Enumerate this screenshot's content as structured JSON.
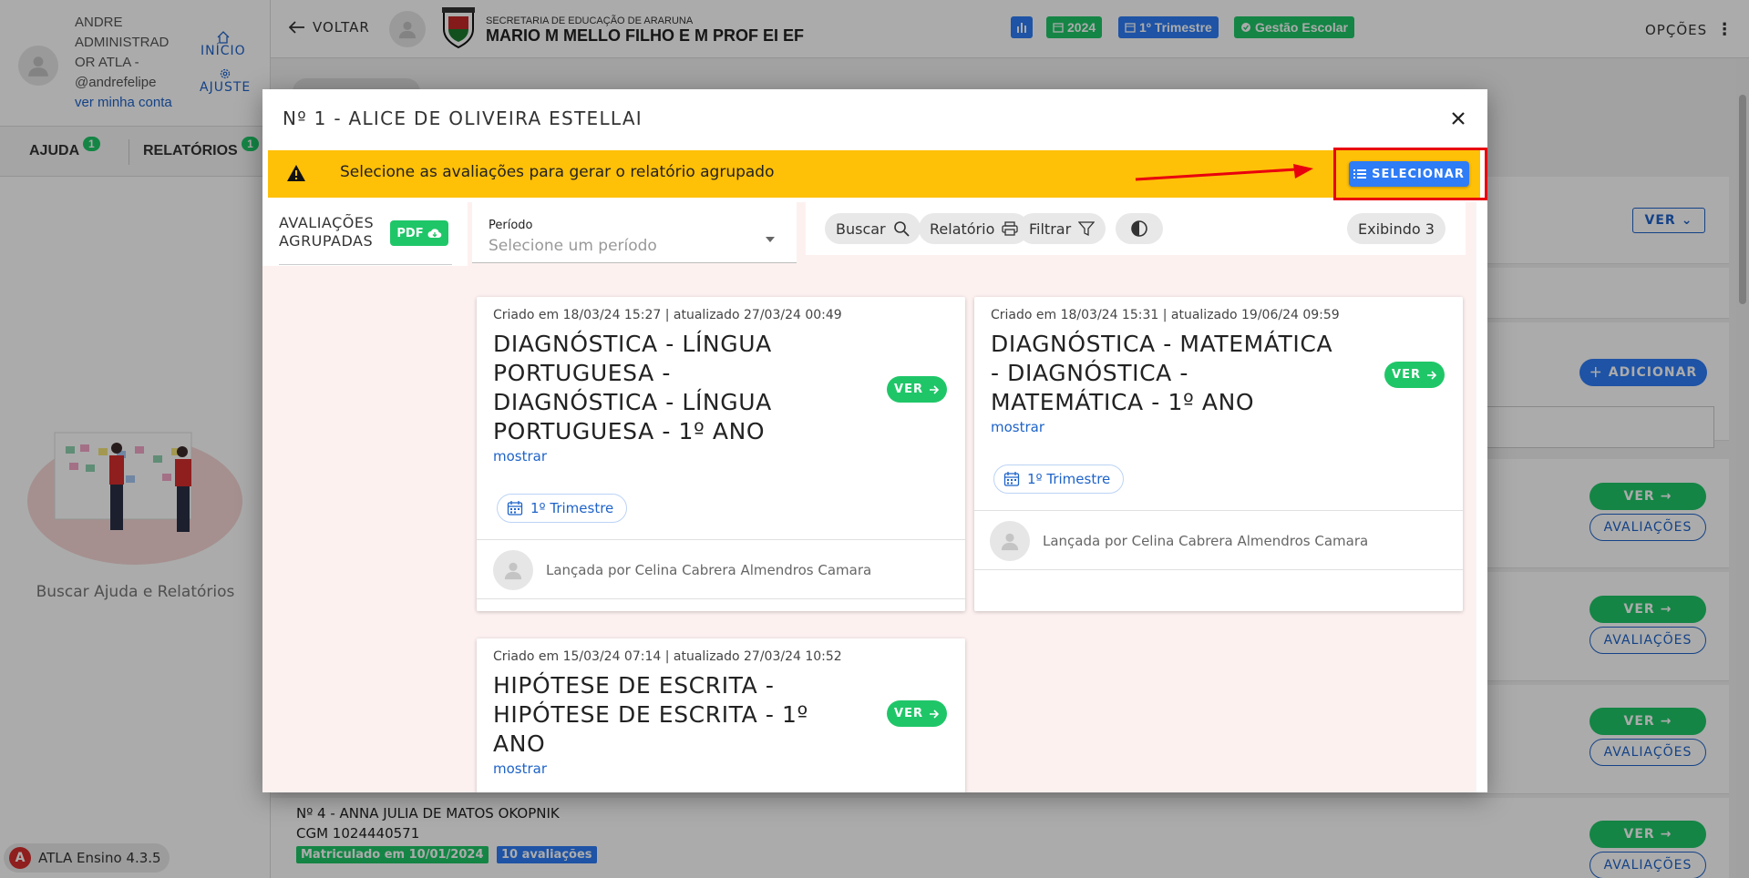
{
  "user": {
    "name": "ANDRE ADMINISTRADOR ATLA -",
    "name_line1": "ANDRE",
    "name_line2": "ADMINISTRAD",
    "name_line3": "OR ATLA -",
    "handle": "@andrefelipe",
    "view_account": "ver minha conta"
  },
  "sidebar": {
    "home_label": "INÍCIO",
    "settings_label": "AJUSTE",
    "tabs": [
      {
        "label": "AJUDA",
        "count": "1"
      },
      {
        "label": "RELATÓRIOS",
        "count": "1"
      }
    ],
    "illustration_caption": "Buscar Ajuda e Relatórios",
    "app_version": "ATLA Ensino 4.3.5"
  },
  "header": {
    "back_label": "VOLTAR",
    "secretaria": "SECRETARIA DE EDUCAÇÃO DE ARARUNA",
    "school": "MARIO M MELLO FILHO E M PROF EI EF",
    "year_badge": "2024",
    "term_badge": "1º Trimestre",
    "gestao_badge": "Gestão Escolar",
    "options_label": "OPÇÕES",
    "colors": {
      "green": "#1fc668",
      "blue": "#2e7cf6"
    }
  },
  "background": {
    "ver_label": "VER",
    "adicionar_label": "ADICIONAR",
    "avaliacoes_label": "AVALIAÇÕES",
    "student4": {
      "name": "Nº 4 - ANNA JULIA DE MATOS OKOPNIK",
      "cgm": "CGM 1024440571",
      "status": "Matriculado em 10/01/2024",
      "evaluations": "10 avaliações"
    }
  },
  "modal": {
    "title": "Nº 1 - ALICE DE OLIVEIRA ESTELLAI",
    "warning_text": "Selecione as avaliações para gerar o relatório agrupado",
    "select_button": "SELECIONAR",
    "grouped_label_1": "AVALIAÇÕES",
    "grouped_label_2": "AGRUPADAS",
    "pdf_label": "PDF",
    "period_label": "Período",
    "period_placeholder": "Selecione um período",
    "toolbar": {
      "search": "Buscar",
      "report": "Relatório",
      "filter": "Filtrar",
      "showing": "Exibindo 3"
    },
    "cards": [
      {
        "meta": "Criado em 18/03/24 15:27 | atualizado 27/03/24 00:49",
        "title": "DIAGNÓSTICA - LÍNGUA PORTUGUESA - DIAGNÓSTICA - LÍNGUA PORTUGUESA - 1º ANO",
        "title_lines": [
          "DIAGNÓSTICA - LÍNGUA",
          "PORTUGUESA -",
          "DIAGNÓSTICA - LÍNGUA",
          "PORTUGUESA - 1º ANO"
        ],
        "more": "mostrar",
        "term": "1º Trimestre",
        "author": "Lançada por Celina Cabrera Almendros Camara",
        "ver": "VER"
      },
      {
        "meta": "Criado em 18/03/24 15:31 | atualizado 19/06/24 09:59",
        "title": "DIAGNÓSTICA - MATEMÁTICA - DIAGNÓSTICA - MATEMÁTICA - 1º ANO",
        "title_lines": [
          "DIAGNÓSTICA - MATEMÁTICA",
          "- DIAGNÓSTICA -",
          "MATEMÁTICA - 1º ANO"
        ],
        "more": "mostrar",
        "term": "1º Trimestre",
        "author": "Lançada por Celina Cabrera Almendros Camara",
        "ver": "VER"
      },
      {
        "meta": "Criado em 15/03/24 07:14 | atualizado 27/03/24 10:52",
        "title": "HIPÓTESE DE ESCRITA - HIPÓTESE DE ESCRITA - 1º ANO",
        "title_lines": [
          "HIPÓTESE DE ESCRITA -",
          "HIPÓTESE DE ESCRITA - 1º",
          "ANO"
        ],
        "more": "mostrar",
        "ver": "VER"
      }
    ]
  }
}
